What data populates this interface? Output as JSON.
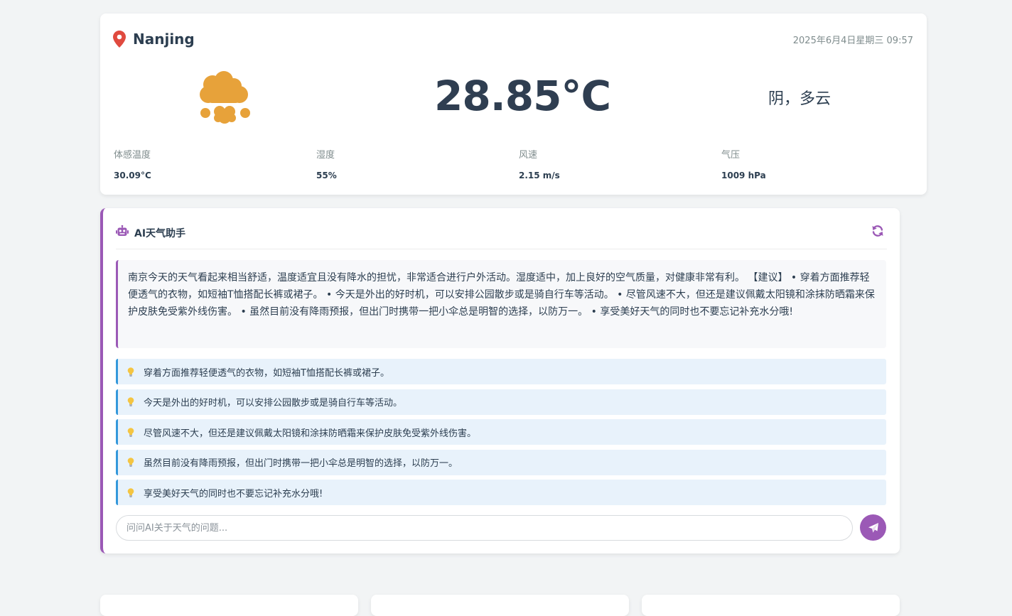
{
  "weather": {
    "city": "Nanjing",
    "datetime": "2025年6月4日星期三 09:57",
    "temperature": "28.85°C",
    "description": "阴，多云",
    "stats": [
      {
        "label": "体感温度",
        "value": "30.09°C"
      },
      {
        "label": "湿度",
        "value": "55%"
      },
      {
        "label": "风速",
        "value": "2.15 m/s"
      },
      {
        "label": "气压",
        "value": "1009 hPa"
      }
    ]
  },
  "ai": {
    "title": "AI天气助手",
    "summary": "南京今天的天气看起来相当舒适，温度适宜且没有降水的担忧，非常适合进行户外活动。湿度适中，加上良好的空气质量，对健康非常有利。 【建议】 • 穿着方面推荐轻便透气的衣物，如短袖T恤搭配长裤或裙子。 • 今天是外出的好时机，可以安排公园散步或是骑自行车等活动。 • 尽管风速不大，但还是建议佩戴太阳镜和涂抹防晒霜来保护皮肤免受紫外线伤害。 • 虽然目前没有降雨预报，但出门时携带一把小伞总是明智的选择，以防万一。 • 享受美好天气的同时也不要忘记补充水分哦!",
    "tips": [
      "穿着方面推荐轻便透气的衣物，如短袖T恤搭配长裤或裙子。",
      "今天是外出的好时机，可以安排公园散步或是骑自行车等活动。",
      "尽管风速不大，但还是建议佩戴太阳镜和涂抹防晒霜来保护皮肤免受紫外线伤害。",
      "虽然目前没有降雨预报，但出门时携带一把小伞总是明智的选择，以防万一。",
      "享受美好天气的同时也不要忘记补充水分哦!"
    ],
    "input_placeholder": "问问AI关于天气的问题..."
  },
  "colors": {
    "accent": "#9b59b6",
    "tip_border": "#3498db",
    "pin": "#e04a3f",
    "weather_icon": "#e7a23a"
  },
  "icons": {
    "location": "map-pin-icon",
    "weather": "cloud-hail-icon",
    "assistant": "robot-icon",
    "refresh": "refresh-icon",
    "tip": "lightbulb-icon",
    "send": "paper-plane-icon"
  }
}
